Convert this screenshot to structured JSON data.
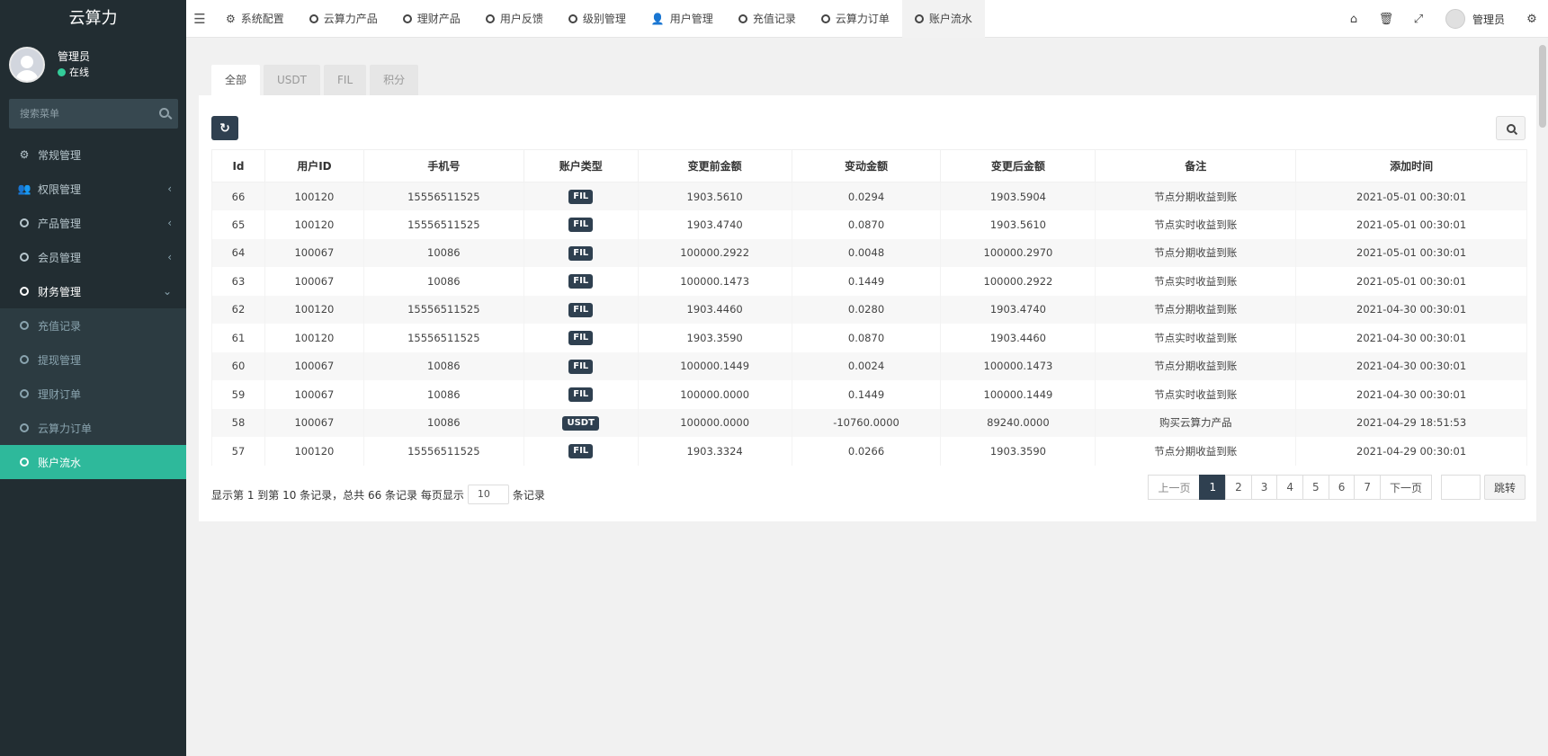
{
  "sidebar": {
    "brand": "云算力",
    "user_name": "管理员",
    "user_status": "在线",
    "search_placeholder": "搜索菜单",
    "menu": [
      {
        "label": "常规管理",
        "icon": "cogs-icon"
      },
      {
        "label": "权限管理",
        "icon": "users-icon",
        "arrow": "‹"
      },
      {
        "label": "产品管理",
        "icon": "circle-icon",
        "arrow": "‹"
      },
      {
        "label": "会员管理",
        "icon": "circle-icon",
        "arrow": "‹"
      },
      {
        "label": "财务管理",
        "icon": "circle-icon",
        "arrow": "⌄"
      }
    ],
    "submenu": [
      "充值记录",
      "提现管理",
      "理财订单",
      "云算力订单",
      "账户流水"
    ]
  },
  "topbar": {
    "tabs": [
      "系统配置",
      "云算力产品",
      "理财产品",
      "用户反馈",
      "级别管理",
      "用户管理",
      "充值记录",
      "云算力订单",
      "账户流水"
    ],
    "user": "管理员"
  },
  "content_tabs": [
    "全部",
    "USDT",
    "FIL",
    "积分"
  ],
  "table": {
    "headers": [
      "Id",
      "用户ID",
      "手机号",
      "账户类型",
      "变更前金额",
      "变动金额",
      "变更后金额",
      "备注",
      "添加时间"
    ],
    "rows": [
      [
        "66",
        "100120",
        "15556511525",
        "FIL",
        "1903.5610",
        "0.0294",
        "1903.5904",
        "节点分期收益到账",
        "2021-05-01 00:30:01"
      ],
      [
        "65",
        "100120",
        "15556511525",
        "FIL",
        "1903.4740",
        "0.0870",
        "1903.5610",
        "节点实时收益到账",
        "2021-05-01 00:30:01"
      ],
      [
        "64",
        "100067",
        "10086",
        "FIL",
        "100000.2922",
        "0.0048",
        "100000.2970",
        "节点分期收益到账",
        "2021-05-01 00:30:01"
      ],
      [
        "63",
        "100067",
        "10086",
        "FIL",
        "100000.1473",
        "0.1449",
        "100000.2922",
        "节点实时收益到账",
        "2021-05-01 00:30:01"
      ],
      [
        "62",
        "100120",
        "15556511525",
        "FIL",
        "1903.4460",
        "0.0280",
        "1903.4740",
        "节点分期收益到账",
        "2021-04-30 00:30:01"
      ],
      [
        "61",
        "100120",
        "15556511525",
        "FIL",
        "1903.3590",
        "0.0870",
        "1903.4460",
        "节点实时收益到账",
        "2021-04-30 00:30:01"
      ],
      [
        "60",
        "100067",
        "10086",
        "FIL",
        "100000.1449",
        "0.0024",
        "100000.1473",
        "节点分期收益到账",
        "2021-04-30 00:30:01"
      ],
      [
        "59",
        "100067",
        "10086",
        "FIL",
        "100000.0000",
        "0.1449",
        "100000.1449",
        "节点实时收益到账",
        "2021-04-30 00:30:01"
      ],
      [
        "58",
        "100067",
        "10086",
        "USDT",
        "100000.0000",
        "-10760.0000",
        "89240.0000",
        "购买云算力产品",
        "2021-04-29 18:51:53"
      ],
      [
        "57",
        "100120",
        "15556511525",
        "FIL",
        "1903.3324",
        "0.0266",
        "1903.3590",
        "节点分期收益到账",
        "2021-04-29 00:30:01"
      ]
    ]
  },
  "pagination": {
    "info_prefix": "显示第 1 到第 10 条记录，总共 66 条记录 每页显示",
    "page_size": "10",
    "info_suffix": "条记录",
    "prev": "上一页",
    "pages": [
      "1",
      "2",
      "3",
      "4",
      "5",
      "6",
      "7"
    ],
    "next": "下一页",
    "jump": "跳转"
  },
  "colors": {
    "sidebar_bg": "#222d32",
    "accent": "#2eb99b",
    "dark_button": "#2f4050"
  }
}
